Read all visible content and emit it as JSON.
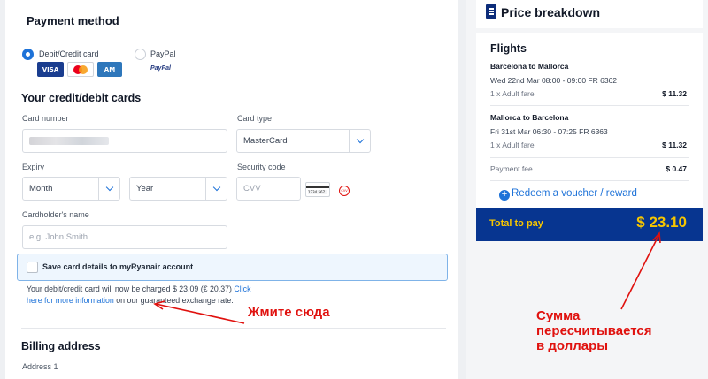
{
  "payment_method": {
    "title": "Payment method",
    "options": [
      {
        "label": "Debit/Credit card",
        "selected": true
      },
      {
        "label": "PayPal",
        "selected": false
      }
    ],
    "card_logos": [
      "VISA",
      "Mastercard",
      "American Express"
    ],
    "paypal_logo": "PayPal"
  },
  "card_form": {
    "title": "Your credit/debit cards",
    "card_number_label": "Card number",
    "card_type_label": "Card type",
    "card_type_value": "MasterCard",
    "expiry_label": "Expiry",
    "month_value": "Month",
    "year_value": "Year",
    "security_label": "Security code",
    "cvv_placeholder": "CVV",
    "cvv_card_digits": "1234 567",
    "cvv_card_circle": "CVV",
    "holder_label": "Cardholder's name",
    "holder_placeholder": "e.g. John Smith",
    "save_label": "Save card details to myRyanair account",
    "note_part1": "Your debit/credit card will now be charged $ 23.09 (€ 20.37)",
    "note_link": "Click here for more information",
    "note_part2": "on our guaranteed exchange rate."
  },
  "billing": {
    "title": "Billing address",
    "address1_label": "Address 1"
  },
  "breakdown": {
    "title": "Price breakdown",
    "icon": "document-icon",
    "flights_title": "Flights",
    "legs": [
      {
        "route": "Barcelona to Mallorca",
        "time": "Wed 22nd Mar 08:00 - 09:00 FR 6362",
        "fare": "1 x Adult fare",
        "price": "$ 11.32"
      },
      {
        "route": "Mallorca to Barcelona",
        "time": "Fri 31st Mar 06:30 - 07:25 FR 6363",
        "fare": "1 x Adult fare",
        "price": "$ 11.32"
      }
    ],
    "payment_fee_label": "Payment fee",
    "payment_fee_value": "$ 0.47",
    "voucher_label": "Redeem a voucher / reward",
    "total_label": "Total to pay",
    "total_value": "$ 23.10"
  },
  "annotations": {
    "click_here": "Жмите сюда",
    "recalc_line1": "Сумма",
    "recalc_line2": "пересчитывается",
    "recalc_line3": "в доллары"
  },
  "colors": {
    "accent": "#1d72d8",
    "navy": "#073590",
    "yellow": "#f7c600",
    "annotation": "#e0110e"
  }
}
